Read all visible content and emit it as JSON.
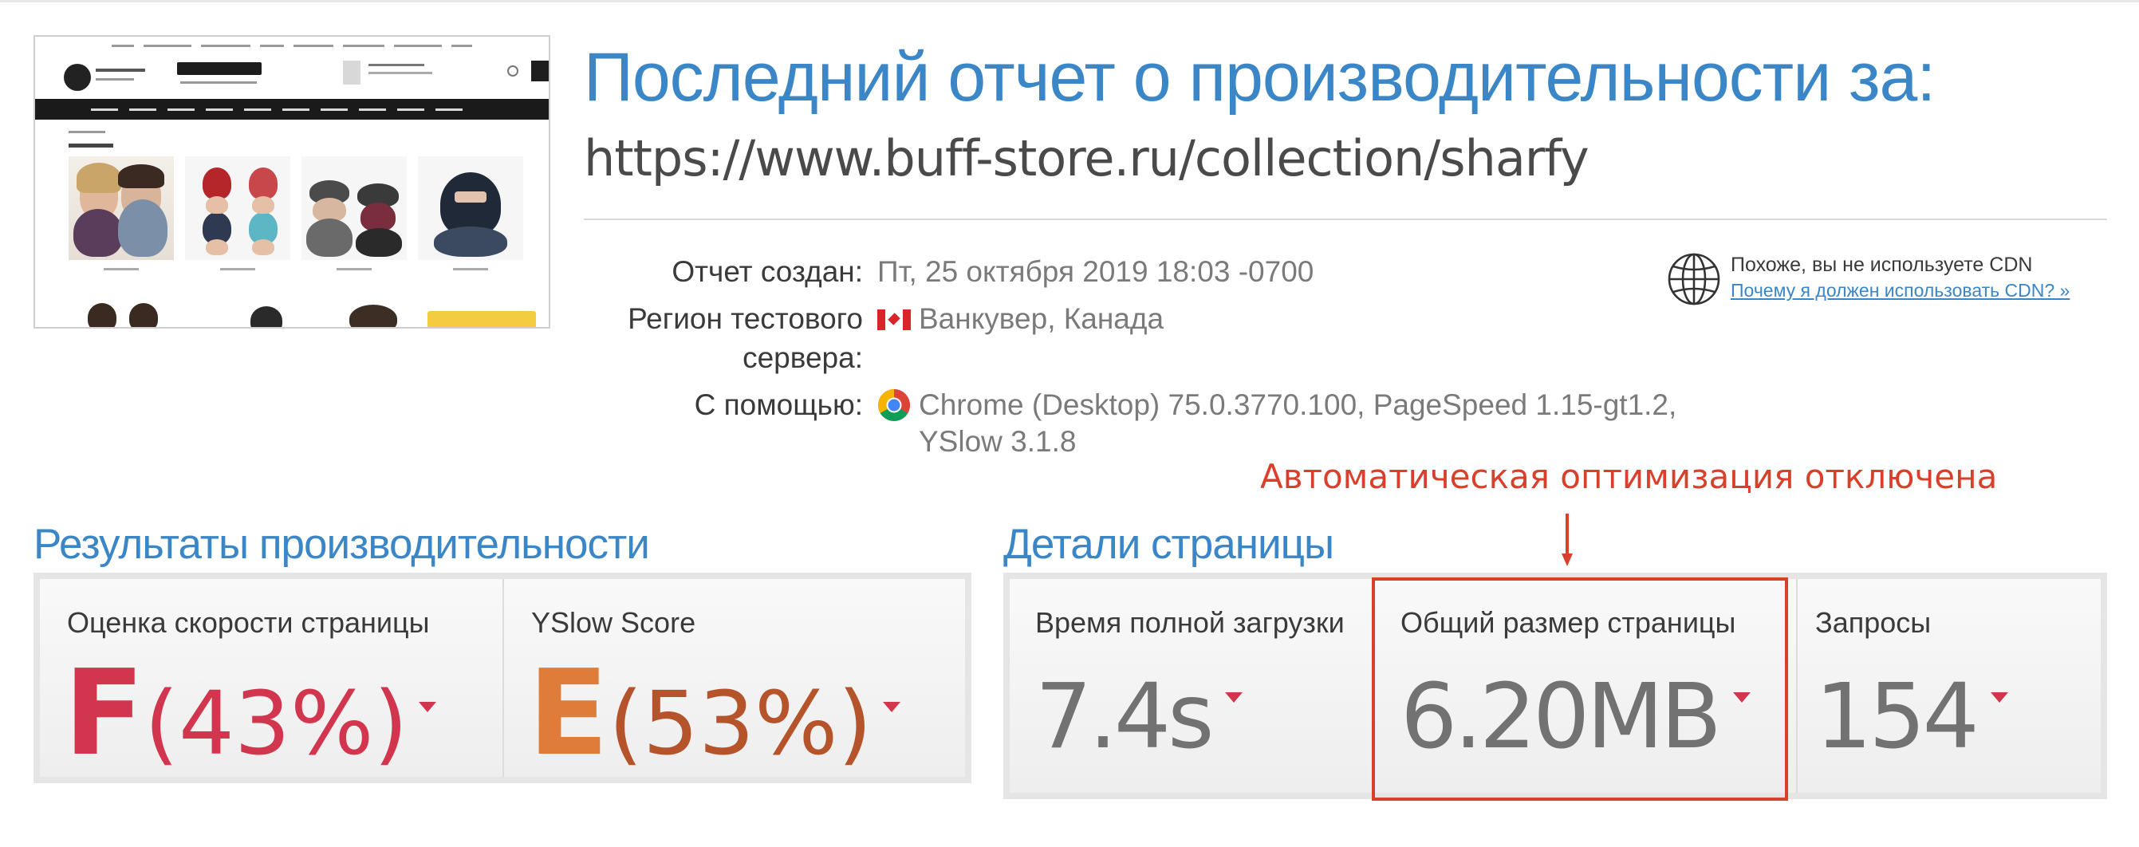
{
  "header": {
    "title": "Последний отчет о производительности за:",
    "url": "https://www.buff-store.ru/collection/sharfy"
  },
  "info": {
    "created_label": "Отчет создан:",
    "created_value": "Пт, 25 октября 2019 18:03 -0700",
    "region_label_1": "Регион тестового",
    "region_label_2": "сервера:",
    "region_value": "Ванкувер, Канада",
    "using_label": "С помощью:",
    "using_value_1": "Chrome (Desktop) 75.0.3770.100, PageSpeed 1.15-gt1.2,",
    "using_value_2": "YSlow 3.1.8"
  },
  "cdn": {
    "text": "Похоже, вы не используете CDN",
    "link": "Почему я должен использовать CDN? »"
  },
  "annotation": "Автоматическая оптимизация отключена",
  "performance": {
    "title": "Результаты производительности",
    "pagespeed_label": "Оценка скорости страницы",
    "pagespeed_grade": "F",
    "pagespeed_pct": "(43%)",
    "yslow_label": "YSlow Score",
    "yslow_grade": "E",
    "yslow_pct": "(53%)"
  },
  "details": {
    "title": "Детали страницы",
    "load_label": "Время полной загрузки",
    "load_value": "7.4s",
    "size_label": "Общий размер страницы",
    "size_value": "6.20MB",
    "requests_label": "Запросы",
    "requests_value": "154"
  },
  "colors": {
    "accent": "#3b86c6",
    "grade_f": "#d2364e",
    "grade_e": "#c0632a",
    "annotation": "#d9402b"
  }
}
